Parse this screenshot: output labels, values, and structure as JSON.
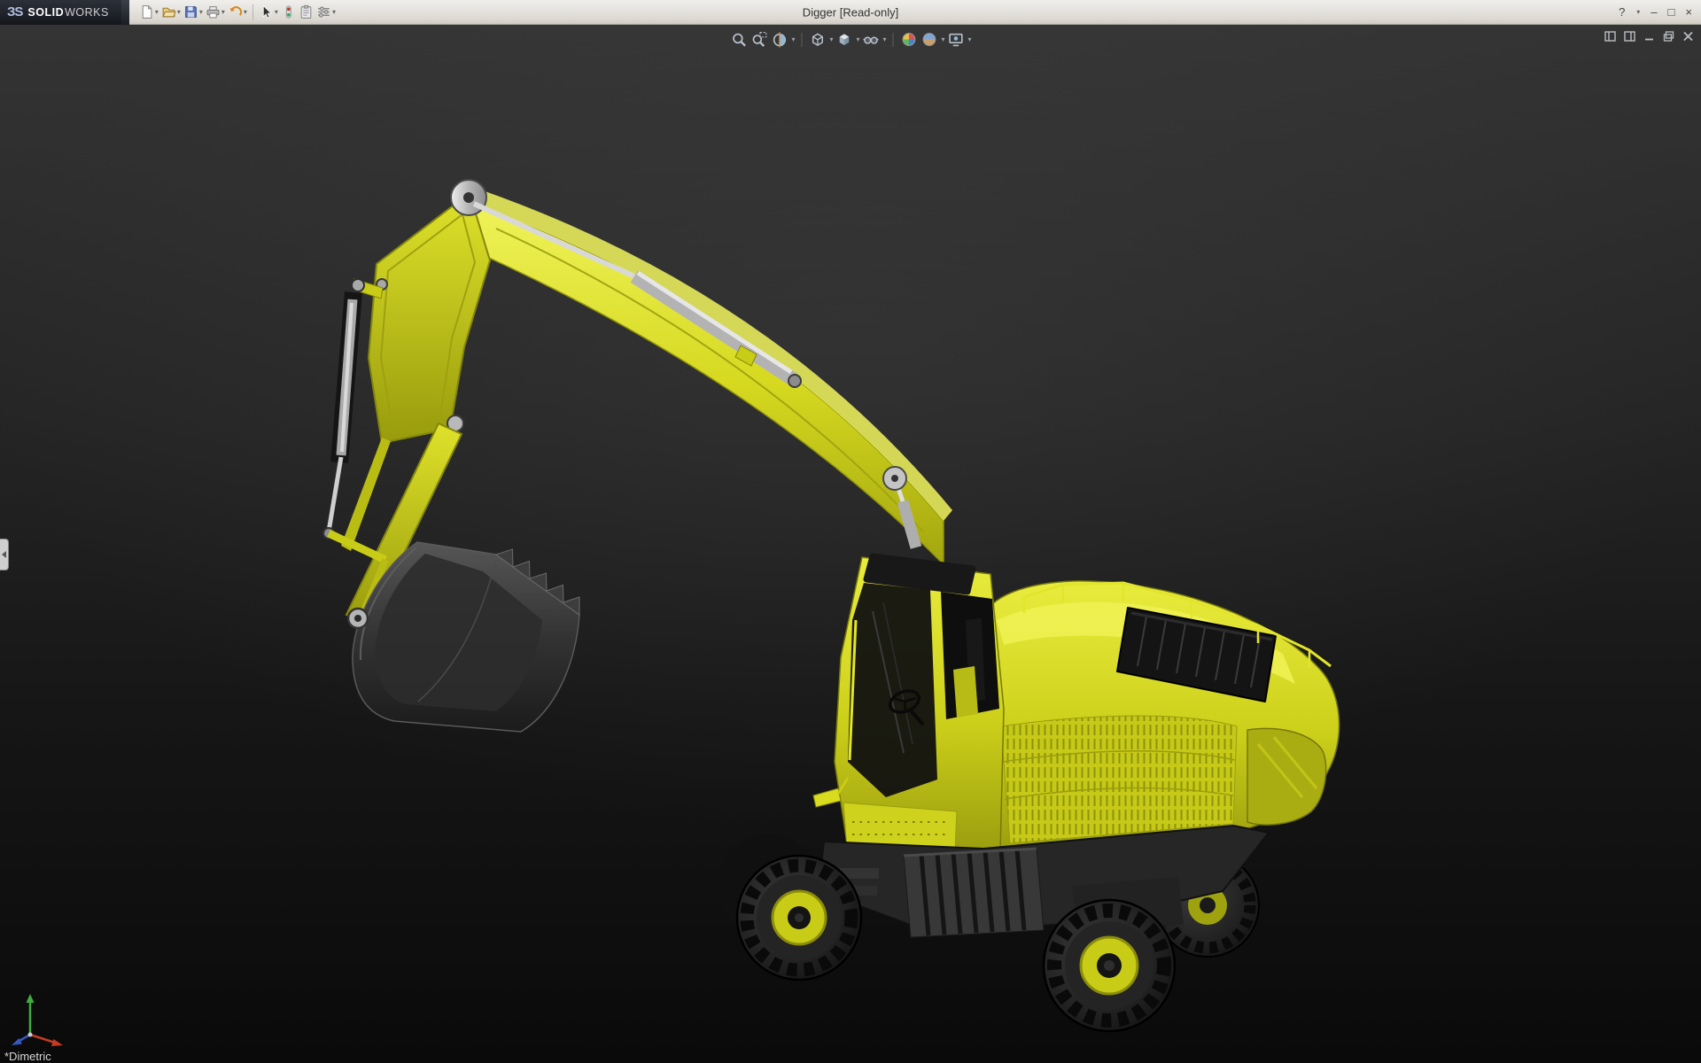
{
  "theme": {
    "titlebar-bg": "#f0efec",
    "titlebar-border": "#a9a7a0",
    "title-text": "#333333",
    "viewport-top": "#343434",
    "viewport-bottom": "#0a0a0a"
  },
  "glyphs": {
    "caret": "▾"
  },
  "titlebar": {
    "logo_mark": "ЗS",
    "brand_bold": "SOLID",
    "brand_light": "WORKS",
    "document_title": "Digger [Read-only]",
    "help_glyph": "?",
    "minimize_glyph": "–",
    "maximize_glyph": "□",
    "close_glyph": "×",
    "toolbar_icons": [
      "new-document",
      "open",
      "save",
      "print",
      "undo",
      "select",
      "xpress-tools",
      "clipboard",
      "options"
    ]
  },
  "viewport": {
    "orientation_label": "*Dimetric",
    "headsup_icons": [
      "zoom-to-fit",
      "zoom-to-area",
      "section-view",
      "view-orientation",
      "display-style",
      "hide-show-items",
      "edit-appearance",
      "apply-scene",
      "view-settings"
    ],
    "window_controls": [
      "restore-left",
      "restore-right",
      "minimize",
      "restore",
      "close"
    ],
    "triad_axes": {
      "x_color": "#c23b22",
      "y_color": "#3fae3f",
      "z_color": "#3558c0"
    }
  },
  "model": {
    "name": "Digger",
    "body_color": "#d8db1e",
    "body_highlight": "#f0f35a",
    "body_shadow": "#a3a60e",
    "bucket_color": "#2e2e2e",
    "metal_color": "#c0c0c0",
    "tire_color": "#181818"
  }
}
